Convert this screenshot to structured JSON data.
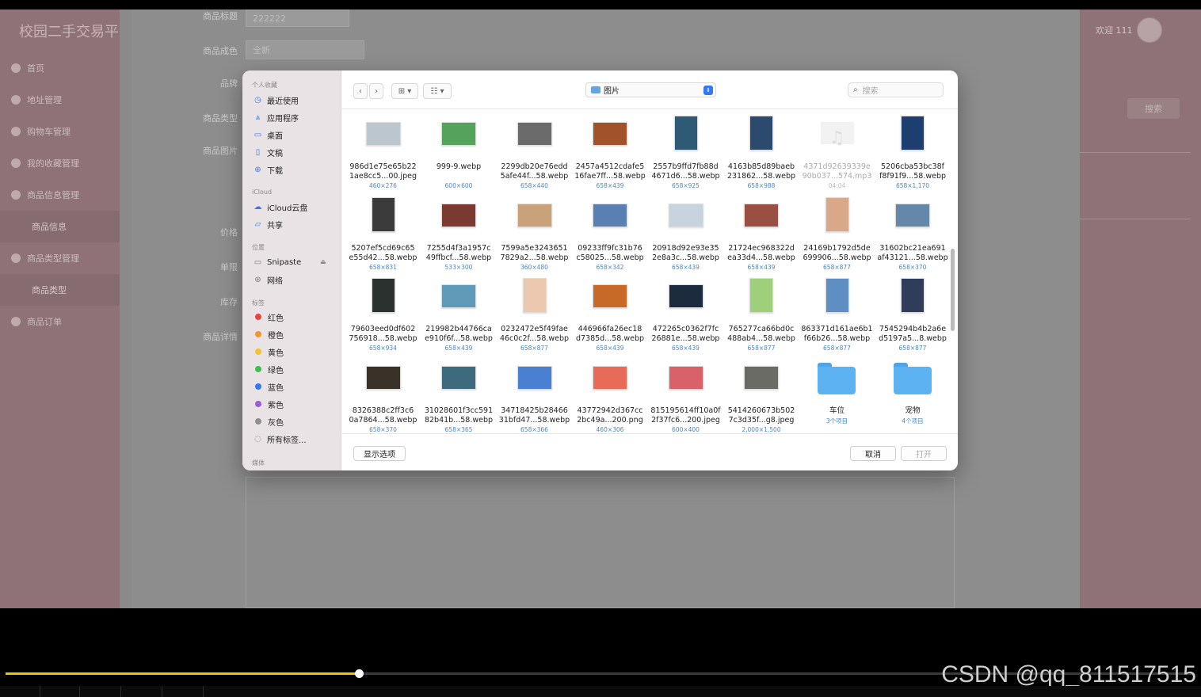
{
  "background_app": {
    "brand": "校园二手交易平",
    "nav": [
      "首页",
      "地址管理",
      "购物车管理",
      "我的收藏管理",
      "商品信息管理",
      "商品类型管理",
      "商品订单"
    ],
    "nav_sub": [
      "商品信息",
      "商品类型"
    ],
    "form_labels": [
      "商品标题",
      "商品成色",
      "品牌",
      "商品类型",
      "商品图片",
      "价格",
      "单限",
      "库存",
      "商品详情"
    ],
    "title_value": "222222",
    "condition_value": "全新",
    "welcome": "欢迎 111",
    "search_button": "搜索"
  },
  "dialog": {
    "sidebar": {
      "favorites_header": "个人收藏",
      "favorites": [
        {
          "label": "最近使用",
          "icon": "clock-icon"
        },
        {
          "label": "应用程序",
          "icon": "apps-icon"
        },
        {
          "label": "桌面",
          "icon": "desktop-icon"
        },
        {
          "label": "文稿",
          "icon": "document-icon"
        },
        {
          "label": "下载",
          "icon": "download-icon"
        }
      ],
      "icloud_header": "iCloud",
      "icloud": [
        {
          "label": "iCloud云盘",
          "icon": "cloud-icon"
        },
        {
          "label": "共享",
          "icon": "shared-folder-icon"
        }
      ],
      "locations_header": "位置",
      "locations": [
        {
          "label": "Snipaste",
          "icon": "drive-icon"
        },
        {
          "label": "网络",
          "icon": "network-icon"
        }
      ],
      "tags_header": "标签",
      "tags": [
        {
          "label": "红色",
          "color": "#e8453c"
        },
        {
          "label": "橙色",
          "color": "#f0962e"
        },
        {
          "label": "黄色",
          "color": "#f2c230"
        },
        {
          "label": "绿色",
          "color": "#3fbf4a"
        },
        {
          "label": "蓝色",
          "color": "#3478f6"
        },
        {
          "label": "紫色",
          "color": "#a358d6"
        },
        {
          "label": "灰色",
          "color": "#8e8e93"
        }
      ],
      "all_tags": "所有标签...",
      "media_header": "媒体"
    },
    "location": "图片",
    "search_placeholder": "搜索",
    "files": [
      {
        "line1": "986d1e75e65b22",
        "line2": "1ae8cc5...00.jpeg",
        "size": "460×276",
        "color": "#bcc6cf"
      },
      {
        "line1": "999-9.webp",
        "line2": "",
        "size": "600×600",
        "color": "#55a35a"
      },
      {
        "line1": "2299db20e76edd",
        "line2": "5afe44f...58.webp",
        "size": "658×440",
        "color": "#6b6b6b"
      },
      {
        "line1": "2457a4512cdafe5",
        "line2": "16fae7ff...58.webp",
        "size": "658×439",
        "color": "#a2522a"
      },
      {
        "line1": "2557b9ffd7fb88d",
        "line2": "4671d6...58.webp",
        "size": "658×925",
        "color": "#2f5a76"
      },
      {
        "line1": "4163b85d89baeb",
        "line2": "231862...58.webp",
        "size": "658×988",
        "color": "#2c4a6e"
      },
      {
        "line1": "4371d92639339e",
        "line2": "90b037...574.mp3",
        "size": "04:04",
        "color": "#f2f2f2",
        "dim": true
      },
      {
        "line1": "5206cba53bc38f",
        "line2": "f8f91f9...58.webp",
        "size": "658×1,170",
        "color": "#1d3f70"
      },
      {
        "line1": "5207ef5cd69c65",
        "line2": "e55d42...58.webp",
        "size": "658×831",
        "color": "#3b3b3b"
      },
      {
        "line1": "7255d4f3a1957c",
        "line2": "49ffbcf...58.webp",
        "size": "533×300",
        "color": "#7a3a32"
      },
      {
        "line1": "7599a5e3243651",
        "line2": "7829a2...58.webp",
        "size": "360×480",
        "color": "#c9a27a"
      },
      {
        "line1": "09233ff9fc31b76",
        "line2": "c58025...58.webp",
        "size": "658×342",
        "color": "#5a7fb2"
      },
      {
        "line1": "20918d92e93e35",
        "line2": "2e8a3c...58.webp",
        "size": "658×439",
        "color": "#c7d3de"
      },
      {
        "line1": "21724ec968322d",
        "line2": "ea33d4...58.webp",
        "size": "658×439",
        "color": "#9b4e42"
      },
      {
        "line1": "24169b1792d5de",
        "line2": "699906...58.webp",
        "size": "658×877",
        "color": "#d9a888"
      },
      {
        "line1": "31602bc21ea691",
        "line2": "af43121...58.webp",
        "size": "658×370",
        "color": "#6688a8"
      },
      {
        "line1": "79603eed0df602",
        "line2": "756918...58.webp",
        "size": "658×934",
        "color": "#2a3230"
      },
      {
        "line1": "219982b44766ca",
        "line2": "e910f6f...58.webp",
        "size": "658×439",
        "color": "#5f9ab8"
      },
      {
        "line1": "0232472e5f49fae",
        "line2": "46c0c2f...58.webp",
        "size": "658×877",
        "color": "#ecc8b0"
      },
      {
        "line1": "446966fa26ec18",
        "line2": "d7385d...58.webp",
        "size": "658×439",
        "color": "#c76a28"
      },
      {
        "line1": "472265c0362f7fc",
        "line2": "26881e...58.webp",
        "size": "658×439",
        "color": "#1c2b3e"
      },
      {
        "line1": "765277ca66bd0c",
        "line2": "488ab4...58.webp",
        "size": "658×877",
        "color": "#9fcf7a"
      },
      {
        "line1": "863371d161ae6b1",
        "line2": "f66b26...58.webp",
        "size": "658×877",
        "color": "#5f8fc2"
      },
      {
        "line1": "7545294b4b2a6e",
        "line2": "d5197a5...8.webp",
        "size": "658×877",
        "color": "#2f3c5a"
      },
      {
        "line1": "8326388c2ff3c6",
        "line2": "0a7864...58.webp",
        "size": "658×370",
        "color": "#3a3228"
      },
      {
        "line1": "31028601f3cc591",
        "line2": "82b41b...58.webp",
        "size": "658×365",
        "color": "#3e6a7e"
      },
      {
        "line1": "34718425b28466",
        "line2": "31bfd47...58.webp",
        "size": "658×366",
        "color": "#4a7fd2"
      },
      {
        "line1": "43772942d367cc",
        "line2": "2bc49a...200.png",
        "size": "460×306",
        "color": "#e86a58"
      },
      {
        "line1": "815195614ff10a0f",
        "line2": "2f37fc6...200.jpeg",
        "size": "600×400",
        "color": "#d9626a"
      },
      {
        "line1": "5414260673b502",
        "line2": "7c3d35f...g8.jpeg",
        "size": "2,000×1,500",
        "color": "#6b6b66"
      },
      {
        "line1": "车位",
        "line2": "",
        "size": "3个项目",
        "folder": true
      },
      {
        "line1": "宠物",
        "line2": "",
        "size": "4个项目",
        "folder": true
      }
    ],
    "show_options": "显示选项",
    "cancel": "取消",
    "open": "打开"
  },
  "watermark": "CSDN @qq_811517515",
  "video_progress": 0.297
}
